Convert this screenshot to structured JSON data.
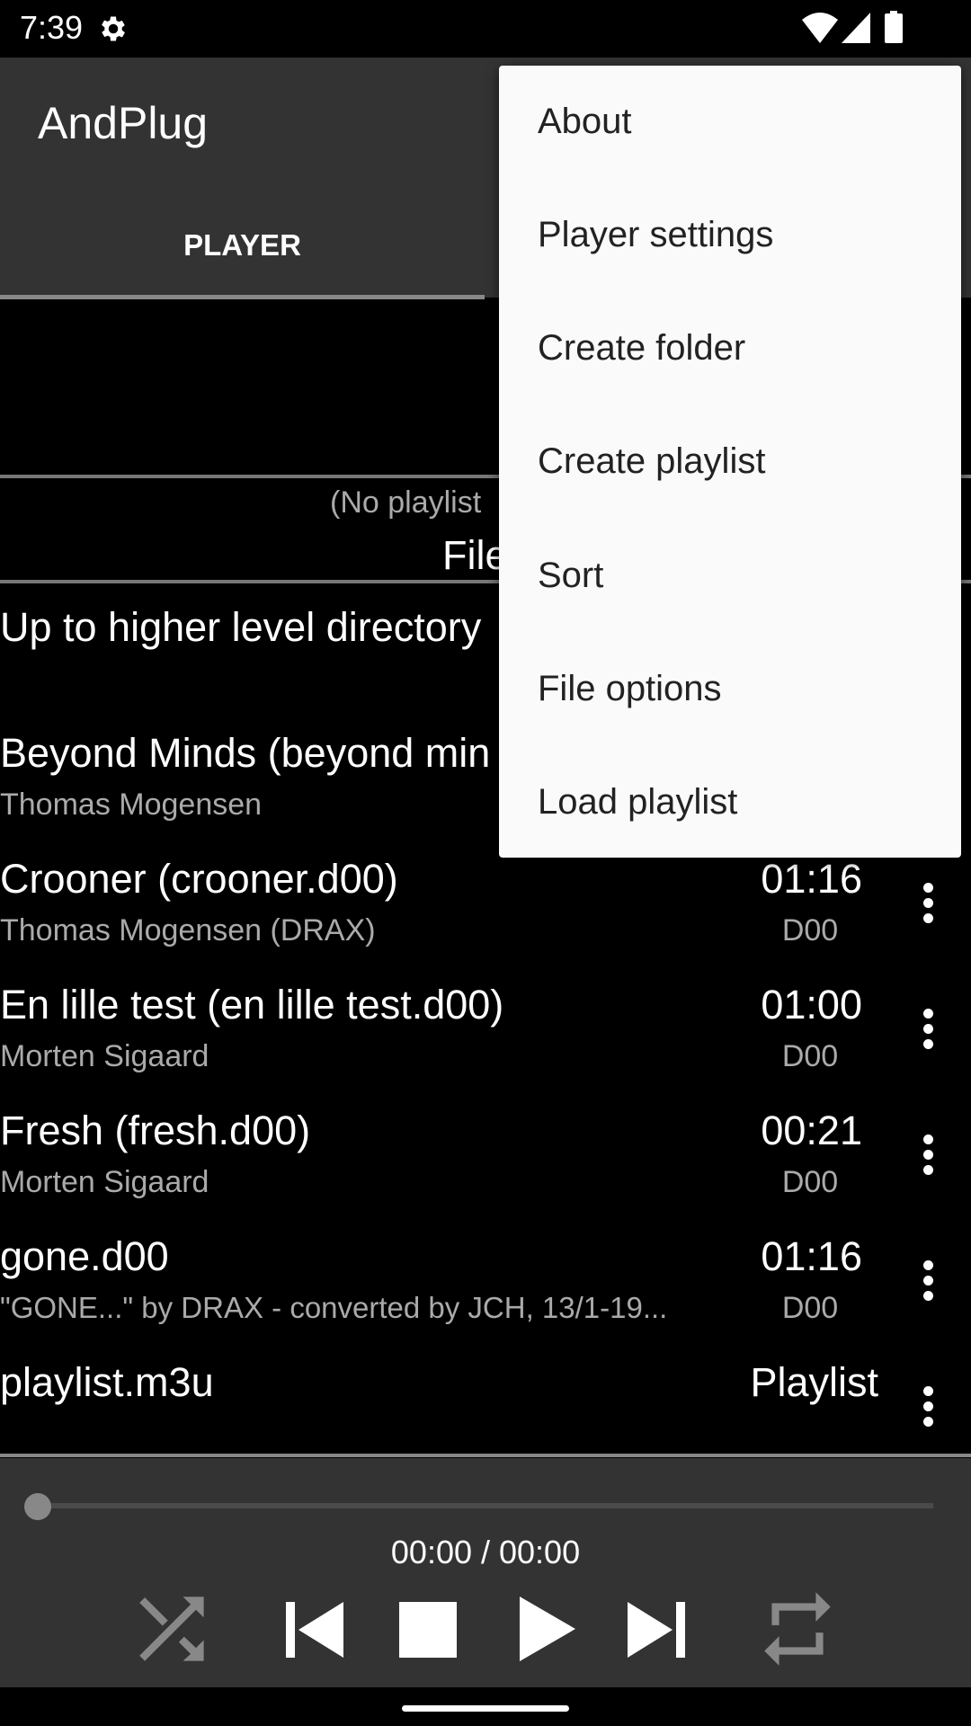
{
  "status_bar": {
    "time": "7:39",
    "icons": [
      "gear-icon",
      "wifi-icon",
      "cell-signal-icon",
      "battery-icon"
    ]
  },
  "app": {
    "title": "AndPlug",
    "tabs": [
      {
        "label": "PLAYER",
        "selected": true
      }
    ]
  },
  "playlist_info": {
    "playlist_text": "(No playlist",
    "section_label": "File"
  },
  "files": {
    "up_dir": "Up to higher level directory",
    "items": [
      {
        "title": "Beyond Minds (beyond min",
        "subtitle": "Thomas Mogensen",
        "duration": "",
        "type": ""
      },
      {
        "title": "Crooner (crooner.d00)",
        "subtitle": "Thomas Mogensen (DRAX)",
        "duration": "01:16",
        "type": "D00"
      },
      {
        "title": "En lille test (en lille test.d00)",
        "subtitle": "Morten Sigaard",
        "duration": "01:00",
        "type": "D00"
      },
      {
        "title": "Fresh (fresh.d00)",
        "subtitle": "Morten Sigaard",
        "duration": "00:21",
        "type": "D00"
      },
      {
        "title": "gone.d00",
        "subtitle": " \"GONE...\" by DRAX - converted by JCH, 13/1-19...",
        "duration": "01:16",
        "type": "D00"
      },
      {
        "title": "playlist.m3u",
        "subtitle": "",
        "duration": "Playlist",
        "type": ""
      }
    ]
  },
  "player": {
    "time_display": "00:00 / 00:00",
    "progress": 0,
    "shuffle_enabled": false,
    "repeat_enabled": false
  },
  "menu": {
    "items": [
      "About",
      "Player settings",
      "Create folder",
      "Create playlist",
      "Sort",
      "File options",
      "Load playlist"
    ]
  },
  "colors": {
    "appbar": "#333333",
    "background": "#000000",
    "menu": "#fafafa",
    "disabled_icon": "#888888"
  }
}
